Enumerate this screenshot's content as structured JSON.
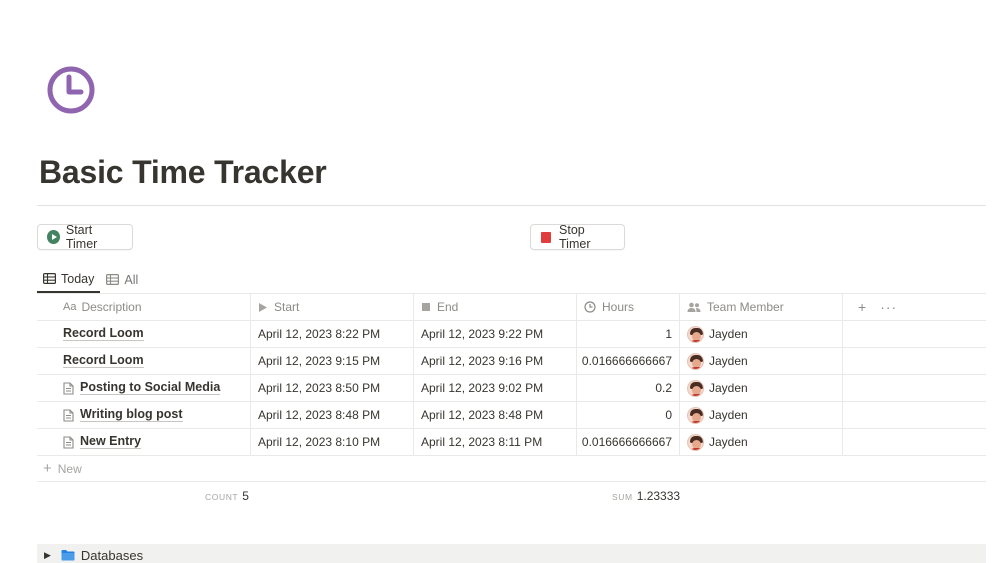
{
  "page": {
    "icon": "clock-icon",
    "icon_color": "#9065b0",
    "title": "Basic Time Tracker"
  },
  "buttons": {
    "start": "Start Timer",
    "stop": "Stop Timer"
  },
  "tabs": [
    {
      "label": "Today",
      "icon": "table-icon",
      "active": true
    },
    {
      "label": "All",
      "icon": "table-icon",
      "active": false
    }
  ],
  "table": {
    "headers": {
      "description": "Description",
      "description_prefix": "Aa",
      "start": "Start",
      "end": "End",
      "hours": "Hours",
      "team": "Team Member"
    },
    "rows": [
      {
        "description": "Record Loom",
        "has_doc_icon": false,
        "start": "April 12, 2023 8:22 PM",
        "end": "April 12, 2023 9:22 PM",
        "hours": "1",
        "member": "Jayden"
      },
      {
        "description": "Record Loom",
        "has_doc_icon": false,
        "start": "April 12, 2023 9:15 PM",
        "end": "April 12, 2023 9:16 PM",
        "hours": "0.016666666667",
        "member": "Jayden"
      },
      {
        "description": "Posting to Social Media",
        "has_doc_icon": true,
        "start": "April 12, 2023 8:50 PM",
        "end": "April 12, 2023 9:02 PM",
        "hours": "0.2",
        "member": "Jayden"
      },
      {
        "description": "Writing blog post",
        "has_doc_icon": true,
        "start": "April 12, 2023 8:48 PM",
        "end": "April 12, 2023 8:48 PM",
        "hours": "0",
        "member": "Jayden"
      },
      {
        "description": "New Entry",
        "has_doc_icon": true,
        "start": "April 12, 2023 8:10 PM",
        "end": "April 12, 2023 8:11 PM",
        "hours": "0.016666666667",
        "member": "Jayden"
      }
    ],
    "new_label": "New",
    "count_label": "COUNT",
    "count_value": "5",
    "sum_label": "SUM",
    "sum_value": "1.23333"
  },
  "toggle": {
    "label": "Databases",
    "icon": "folder-icon",
    "icon_color": "#2383e2"
  }
}
